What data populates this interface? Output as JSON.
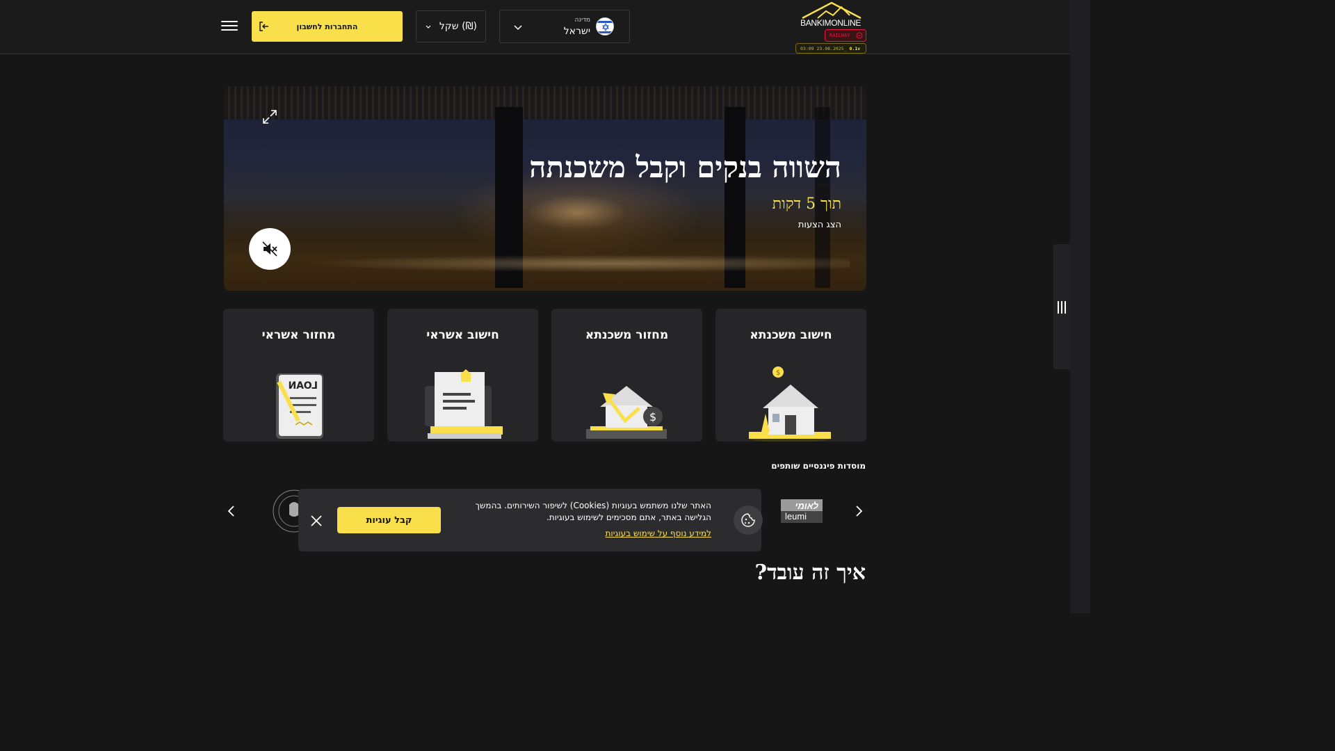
{
  "header": {
    "login_label": "התחברות לחשבון",
    "currency_label": "(₪) שקל",
    "country_small_label": "מדינה",
    "country_value": "ישראל",
    "logo_text": "BANKIMONLINE",
    "logo_bold": "BANKIM",
    "logo_light": "ONLINE",
    "railway_label": "RAILWAY",
    "timestamp": "03:09 23.08.2025_",
    "version": "0.1v"
  },
  "hero": {
    "title": "השווה בנקים וקבל משכנתה",
    "subtitle": "תוך 5 דקות",
    "link": "הצג הצעות"
  },
  "cards": [
    {
      "title": "חישוב משכנתא",
      "icon": "house-coin-icon"
    },
    {
      "title": "מחזור משכנתא",
      "icon": "house-refinance-icon"
    },
    {
      "title": "חישוב אשראי",
      "icon": "laptop-document-icon"
    },
    {
      "title": "מחזור אשראי",
      "icon": "loan-document-icon"
    }
  ],
  "partners": {
    "title": "מוסדות פיננסיים שותפים",
    "leumi_he": "לאומי",
    "leumi_en": "leumi"
  },
  "cookie": {
    "text": "האתר שלנו משתמש בעוגיות (Cookies) לשיפור השירותים. בהמשך הגלישה באתר, אתם מסכימים לשימוש בעוגיות.",
    "link": "למידע נוסף על שימוש בעוגיות",
    "accept": "קבל עוגיות"
  },
  "how_it_works_title": "איך זה עובד?",
  "colors": {
    "accent": "#f9e04b",
    "background": "#161616",
    "card": "#262628"
  }
}
